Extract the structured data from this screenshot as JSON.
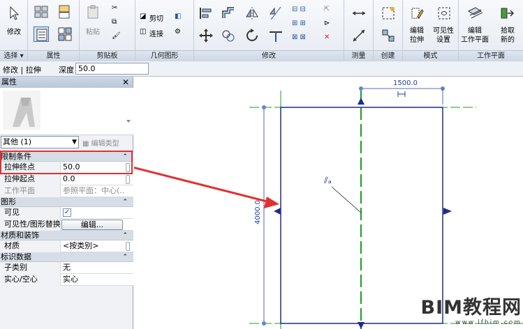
{
  "ribbon": {
    "panels": [
      {
        "label": "选择 ▾"
      },
      {
        "label": "属性"
      },
      {
        "label": "剪贴板"
      },
      {
        "label": "几何图形"
      },
      {
        "label": "修改"
      },
      {
        "label": "测量"
      },
      {
        "label": "创建"
      },
      {
        "label": "模式"
      },
      {
        "label": "工作平面"
      }
    ],
    "modify_label": "修改",
    "paste_label": "粘贴",
    "cut_label": "剪切",
    "join_label": "连接",
    "edit_extrusion_label": "编辑\n拉伸",
    "visibility_label": "可见性\n设置",
    "edit_workplane_label": "编辑\n工作平面",
    "pick_new_label": "拾取\n新的"
  },
  "optbar": {
    "context": "修改 | 拉伸",
    "depth_label": "深度",
    "depth_value": "50.0"
  },
  "properties": {
    "title": "属性",
    "close": "✕",
    "type_selector": "其他 (1)",
    "edit_type": "编辑类型",
    "sections": [
      {
        "label": "限制条件",
        "rows": [
          {
            "key": "拉伸终点",
            "value": "50.0"
          },
          {
            "key": "拉伸起点",
            "value": "0.0"
          },
          {
            "key": "工作平面",
            "value": "参照平面：中心(..."
          }
        ]
      },
      {
        "label": "图形",
        "rows": [
          {
            "key": "可见",
            "value": "✓"
          },
          {
            "key": "可见性/图形替换",
            "value": "编辑..."
          }
        ]
      },
      {
        "label": "材质和装饰",
        "rows": [
          {
            "key": "材质",
            "value": "<按类别>"
          }
        ]
      },
      {
        "label": "标识数据",
        "rows": [
          {
            "key": "子类别",
            "value": "无"
          },
          {
            "key": "实心/空心",
            "value": "实心"
          }
        ]
      }
    ]
  },
  "canvas": {
    "dim_width": "1500.0",
    "dim_height": "4000.0"
  },
  "watermark": {
    "main": "BIM教程网",
    "sub": "www.lfbim.com"
  },
  "colors": {
    "highlight": "#e03030",
    "geometry": "#1f2a8a",
    "refplane": "#1e9a2a",
    "dimension": "#1f3fa0"
  }
}
